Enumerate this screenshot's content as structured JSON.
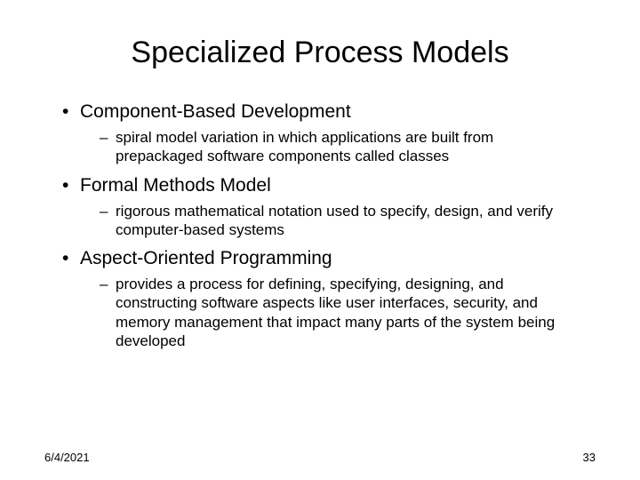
{
  "title": "Specialized Process Models",
  "items": [
    {
      "heading": "Component-Based Development",
      "sub": "spiral model variation in which applications are built from prepackaged software components called classes"
    },
    {
      "heading": "Formal Methods Model",
      "sub": "rigorous mathematical notation used to specify, design, and verify computer-based systems"
    },
    {
      "heading": "Aspect-Oriented Programming",
      "sub": "provides a process for defining, specifying, designing, and constructing software aspects like user interfaces, security, and memory management that impact many parts of the system being developed"
    }
  ],
  "footer": {
    "date": "6/4/2021",
    "page": "33"
  }
}
